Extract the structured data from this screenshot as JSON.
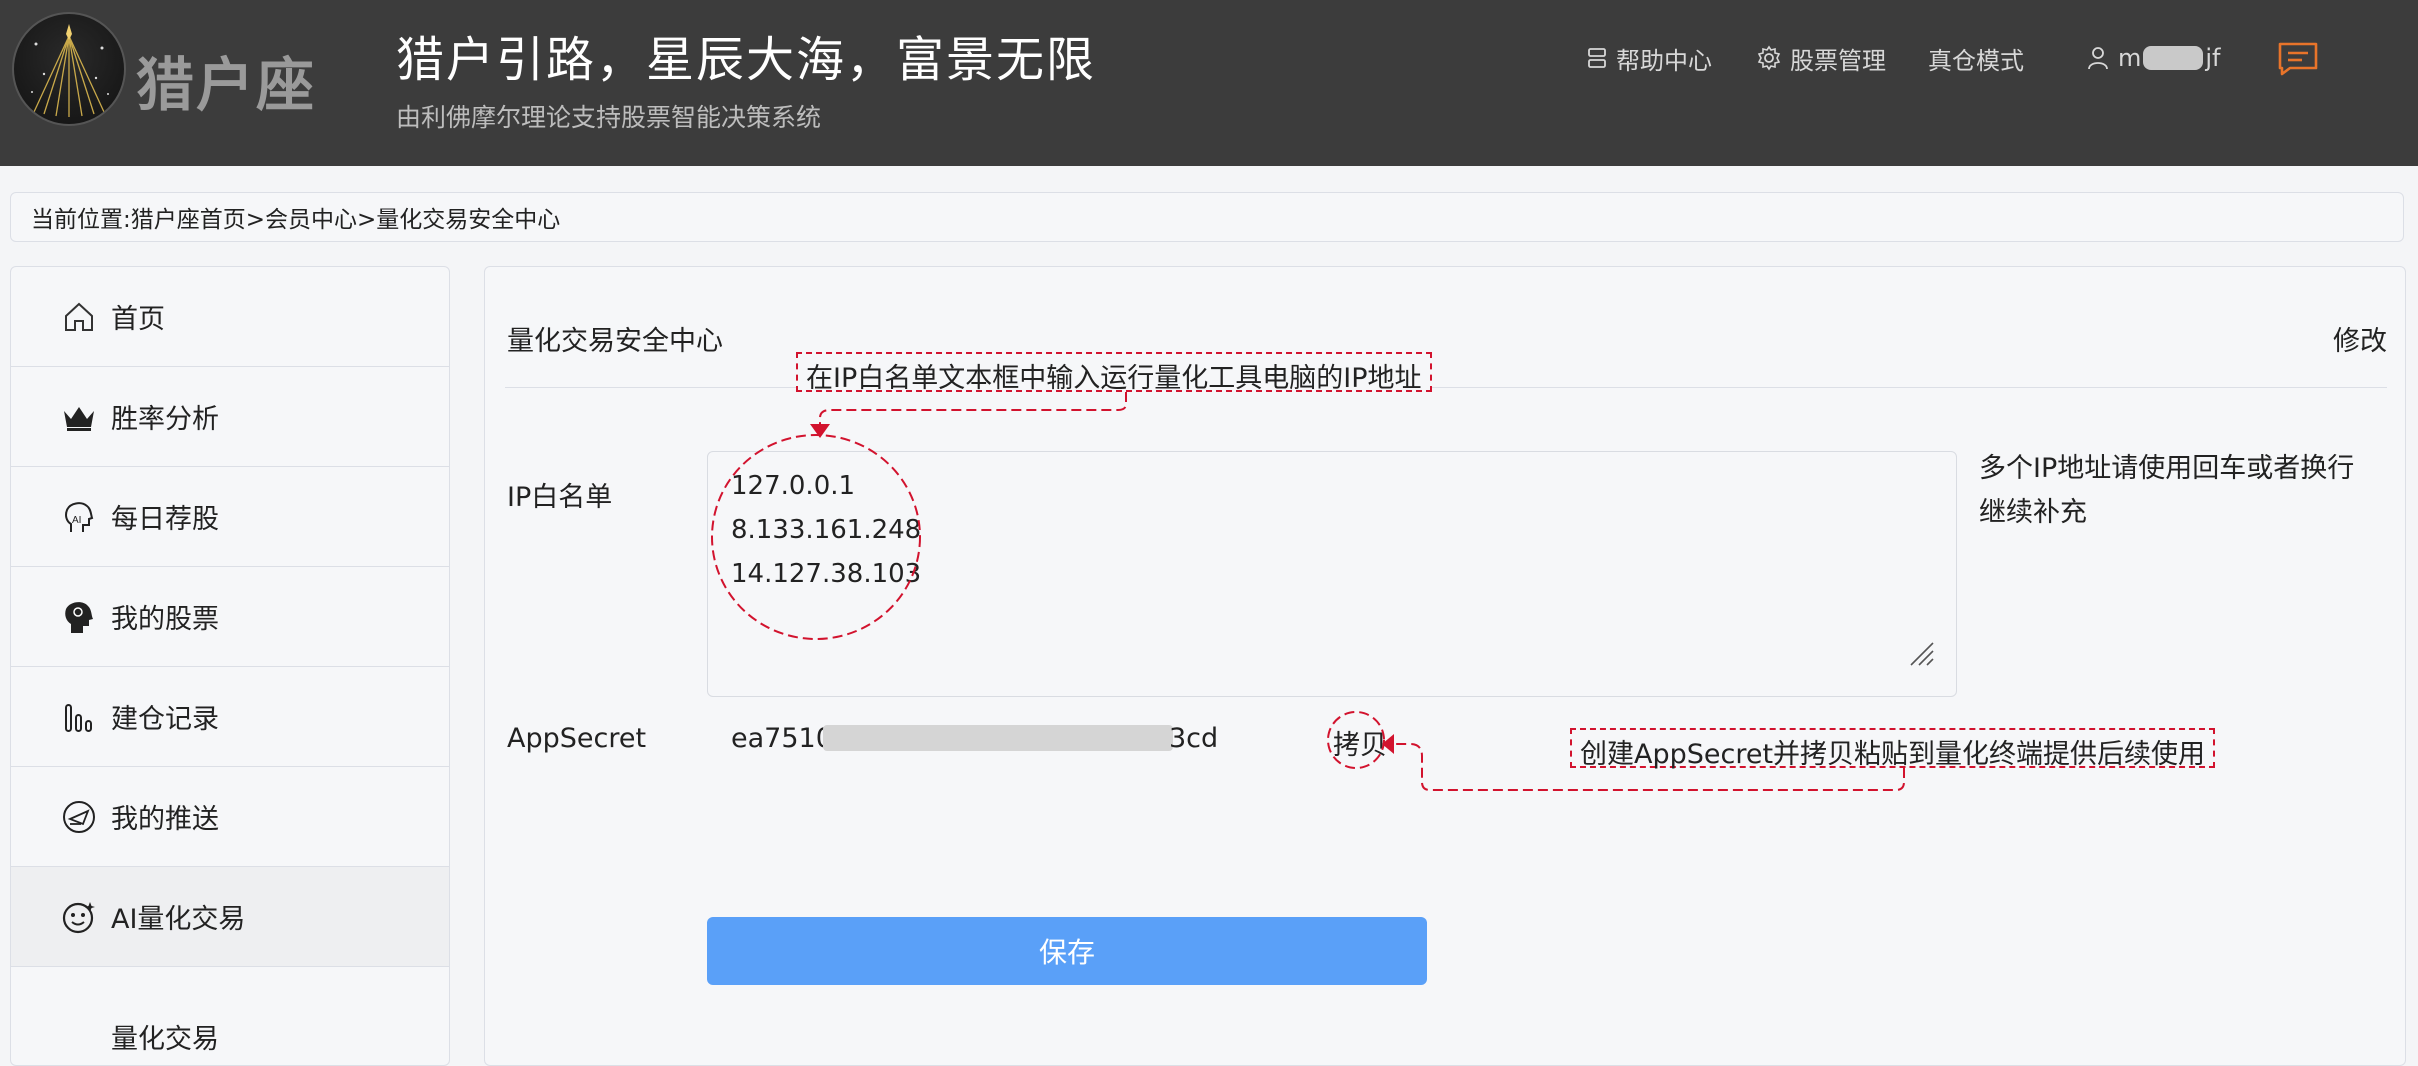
{
  "header": {
    "logo_text": "猎户座",
    "slogan": "猎户引路，星辰大海，富景无限",
    "subslogan": "由利佛摩尔理论支持股票智能决策系统",
    "nav": [
      {
        "label": "帮助中心",
        "icon": "help-icon"
      },
      {
        "label": "股票管理",
        "icon": "gear-icon"
      },
      {
        "label": "真仓模式",
        "icon": ""
      }
    ],
    "user": {
      "prefix": "m",
      "suffix": "jf",
      "icon": "user-icon"
    },
    "message_icon": "message-icon"
  },
  "breadcrumb": "当前位置:猎户座首页>会员中心>量化交易安全中心",
  "sidebar": {
    "items": [
      {
        "label": "首页",
        "icon": "home-icon"
      },
      {
        "label": "胜率分析",
        "icon": "crown-icon"
      },
      {
        "label": "每日荐股",
        "icon": "ai-head-icon"
      },
      {
        "label": "我的股票",
        "icon": "brain-head-icon"
      },
      {
        "label": "建仓记录",
        "icon": "bar-chart-icon"
      },
      {
        "label": "我的推送",
        "icon": "push-icon"
      },
      {
        "label": "AI量化交易",
        "icon": "robot-face-icon"
      }
    ],
    "sub_item": "量化交易"
  },
  "panel": {
    "title": "量化交易安全中心",
    "edit_label": "修改",
    "ip_label": "IP白名单",
    "ip_lines": [
      "127.0.0.1",
      "8.133.161.248",
      "14.127.38.103"
    ],
    "ip_hint": "多个IP地址请使用回车或者换行继续补充",
    "secret_label": "AppSecret",
    "secret_prefix": "ea7510",
    "secret_suffix": "3cd",
    "copy_label": "拷贝",
    "save_label": "保存"
  },
  "annotations": {
    "ip_note": "在IP白名单文本框中输入运行量化工具电脑的IP地址",
    "secret_note": "创建AppSecret并拷贝粘贴到量化终端提供后续使用"
  },
  "colors": {
    "header_bg": "#3c3c3c",
    "accent": "#5aa0f8",
    "annotation": "#d2132e",
    "message_icon": "#e8742a"
  }
}
